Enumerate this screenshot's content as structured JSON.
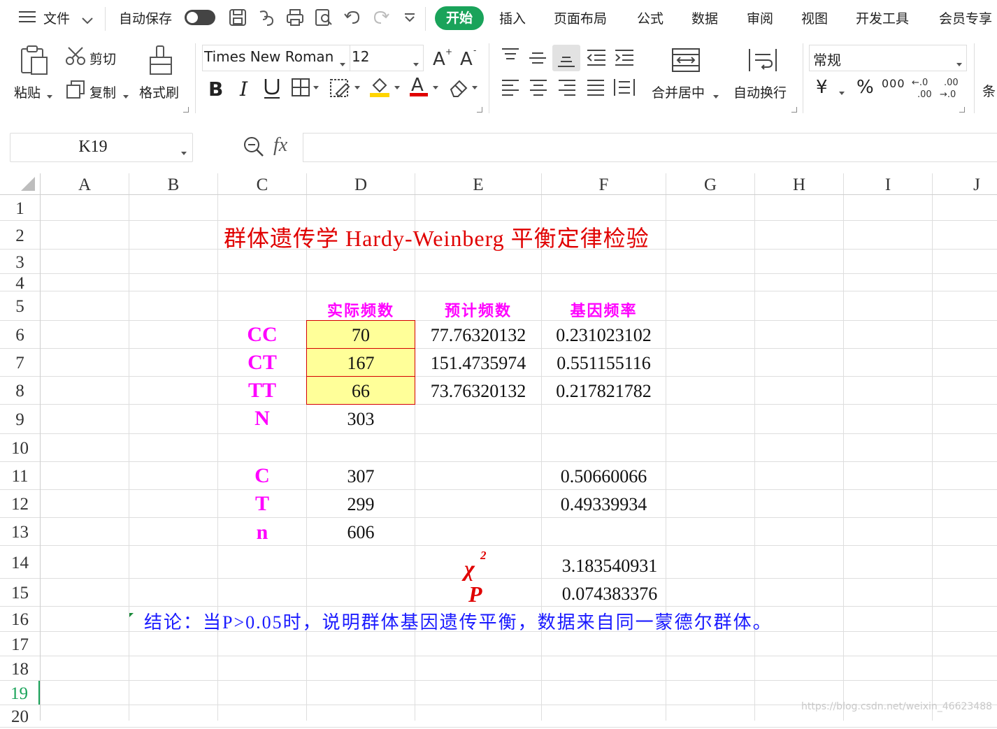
{
  "menubar": {
    "hamburger_icon": "menu-icon",
    "file_label": "文件",
    "autosave_label": "自动保存",
    "tabs": [
      "开始",
      "插入",
      "页面布局",
      "公式",
      "数据",
      "审阅",
      "视图",
      "开发工具",
      "会员专享"
    ],
    "active_tab": "开始"
  },
  "ribbon": {
    "paste_label": "粘贴",
    "cut_label": "剪切",
    "copy_label": "复制",
    "format_painter_label": "格式刷",
    "font_name": "Times New Roman",
    "font_size": "12",
    "merge_label": "合并居中",
    "wrap_label": "自动换行",
    "number_format": "常规",
    "condition_partial": "条",
    "currency_symbol": "¥",
    "percent_symbol": "%",
    "thousands_symbol": "000"
  },
  "formula_bar": {
    "cell_ref": "K19",
    "fx_label": "fx",
    "formula": ""
  },
  "columns": [
    "A",
    "B",
    "C",
    "D",
    "E",
    "F",
    "G",
    "H",
    "I",
    "J"
  ],
  "rows": [
    "1",
    "2",
    "3",
    "4",
    "5",
    "6",
    "7",
    "8",
    "9",
    "10",
    "11",
    "12",
    "13",
    "14",
    "15",
    "16",
    "17",
    "18",
    "19",
    "20"
  ],
  "selected_row": "19",
  "sheet": {
    "title": "群体遗传学  Hardy-Weinberg  平衡定律检验",
    "headers": {
      "actual": "实际频数",
      "expected": "预计频数",
      "gene_freq": "基因频率"
    },
    "genotypes": [
      {
        "label": "CC",
        "actual": "70",
        "expected": "77.76320132",
        "freq": "0.231023102"
      },
      {
        "label": "CT",
        "actual": "167",
        "expected": "151.4735974",
        "freq": "0.551155116"
      },
      {
        "label": "TT",
        "actual": "66",
        "expected": "73.76320132",
        "freq": "0.217821782"
      }
    ],
    "N": {
      "label": "N",
      "value": "303"
    },
    "alleles": [
      {
        "label": "C",
        "value": "307",
        "freq": "0.50660066"
      },
      {
        "label": "T",
        "value": "299",
        "freq": "0.49339934"
      }
    ],
    "n": {
      "label": "n",
      "value": "606"
    },
    "chi": {
      "symbol": "χ",
      "sup": "2",
      "value": "3.183540931"
    },
    "p": {
      "symbol": "P",
      "value": "0.074383376"
    },
    "conclusion": "结论：当P>0.05时，说明群体基因遗传平衡，数据来自同一蒙德尔群体。"
  },
  "watermark": "https://blog.csdn.net/weixin_46623488",
  "colors": {
    "accent_green": "#1aa35a",
    "magenta": "#ff00ff",
    "red": "#e00000",
    "blue": "#1a1aff",
    "highlight": "#ffff99"
  }
}
